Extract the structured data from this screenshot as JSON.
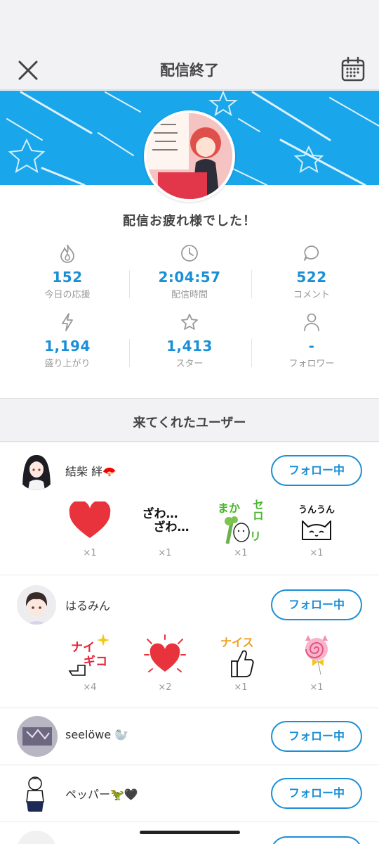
{
  "header": {
    "title": "配信終了",
    "close_icon": "close-icon",
    "calendar_icon": "calendar-icon"
  },
  "summary": {
    "thanks": "配信お疲れ様でした！"
  },
  "stats": [
    {
      "icon": "flame-icon",
      "value": "152",
      "label": "今日の応援"
    },
    {
      "icon": "clock-icon",
      "value": "2:04:57",
      "label": "配信時間"
    },
    {
      "icon": "comment-icon",
      "value": "522",
      "label": "コメント"
    },
    {
      "icon": "lightning-icon",
      "value": "1,194",
      "label": "盛り上がり"
    },
    {
      "icon": "star-icon",
      "value": "1,413",
      "label": "スター"
    },
    {
      "icon": "person-icon",
      "value": "-",
      "label": "フォロワー"
    }
  ],
  "users_section": {
    "title": "来てくれたユーザー"
  },
  "users": [
    {
      "name": "結柴 絆🪭",
      "follow_label": "フォロー中",
      "stamps": [
        {
          "icon": "heart-stamp",
          "count": "×1"
        },
        {
          "icon": "zawazawa-stamp",
          "text1": "ざわ…",
          "text2": "ざわ…",
          "count": "×1"
        },
        {
          "icon": "makaseroli-stamp",
          "text1": "まか",
          "text2": "セロ",
          "text3": "リ",
          "count": "×1"
        },
        {
          "icon": "unun-cat-stamp",
          "text1": "うんうん",
          "count": "×1"
        }
      ]
    },
    {
      "name": "はるみん",
      "follow_label": "フォロー中",
      "stamps": [
        {
          "icon": "nice-kiko-stamp",
          "text1": "ナイ",
          "text2": "ギコ",
          "count": "×4"
        },
        {
          "icon": "heart-burst-stamp",
          "count": "×2"
        },
        {
          "icon": "nice-thumbs-stamp",
          "text1": "ナイス",
          "count": "×1"
        },
        {
          "icon": "lollipop-cat-stamp",
          "count": "×1"
        }
      ]
    },
    {
      "name": "seelöwe 🦭",
      "follow_label": "フォロー中"
    },
    {
      "name": "ペッパー🦖🖤",
      "follow_label": "フォロー中"
    }
  ],
  "colors": {
    "accent": "#1b8fd6",
    "banner": "#1aa6ea",
    "heart": "#e8333c"
  }
}
